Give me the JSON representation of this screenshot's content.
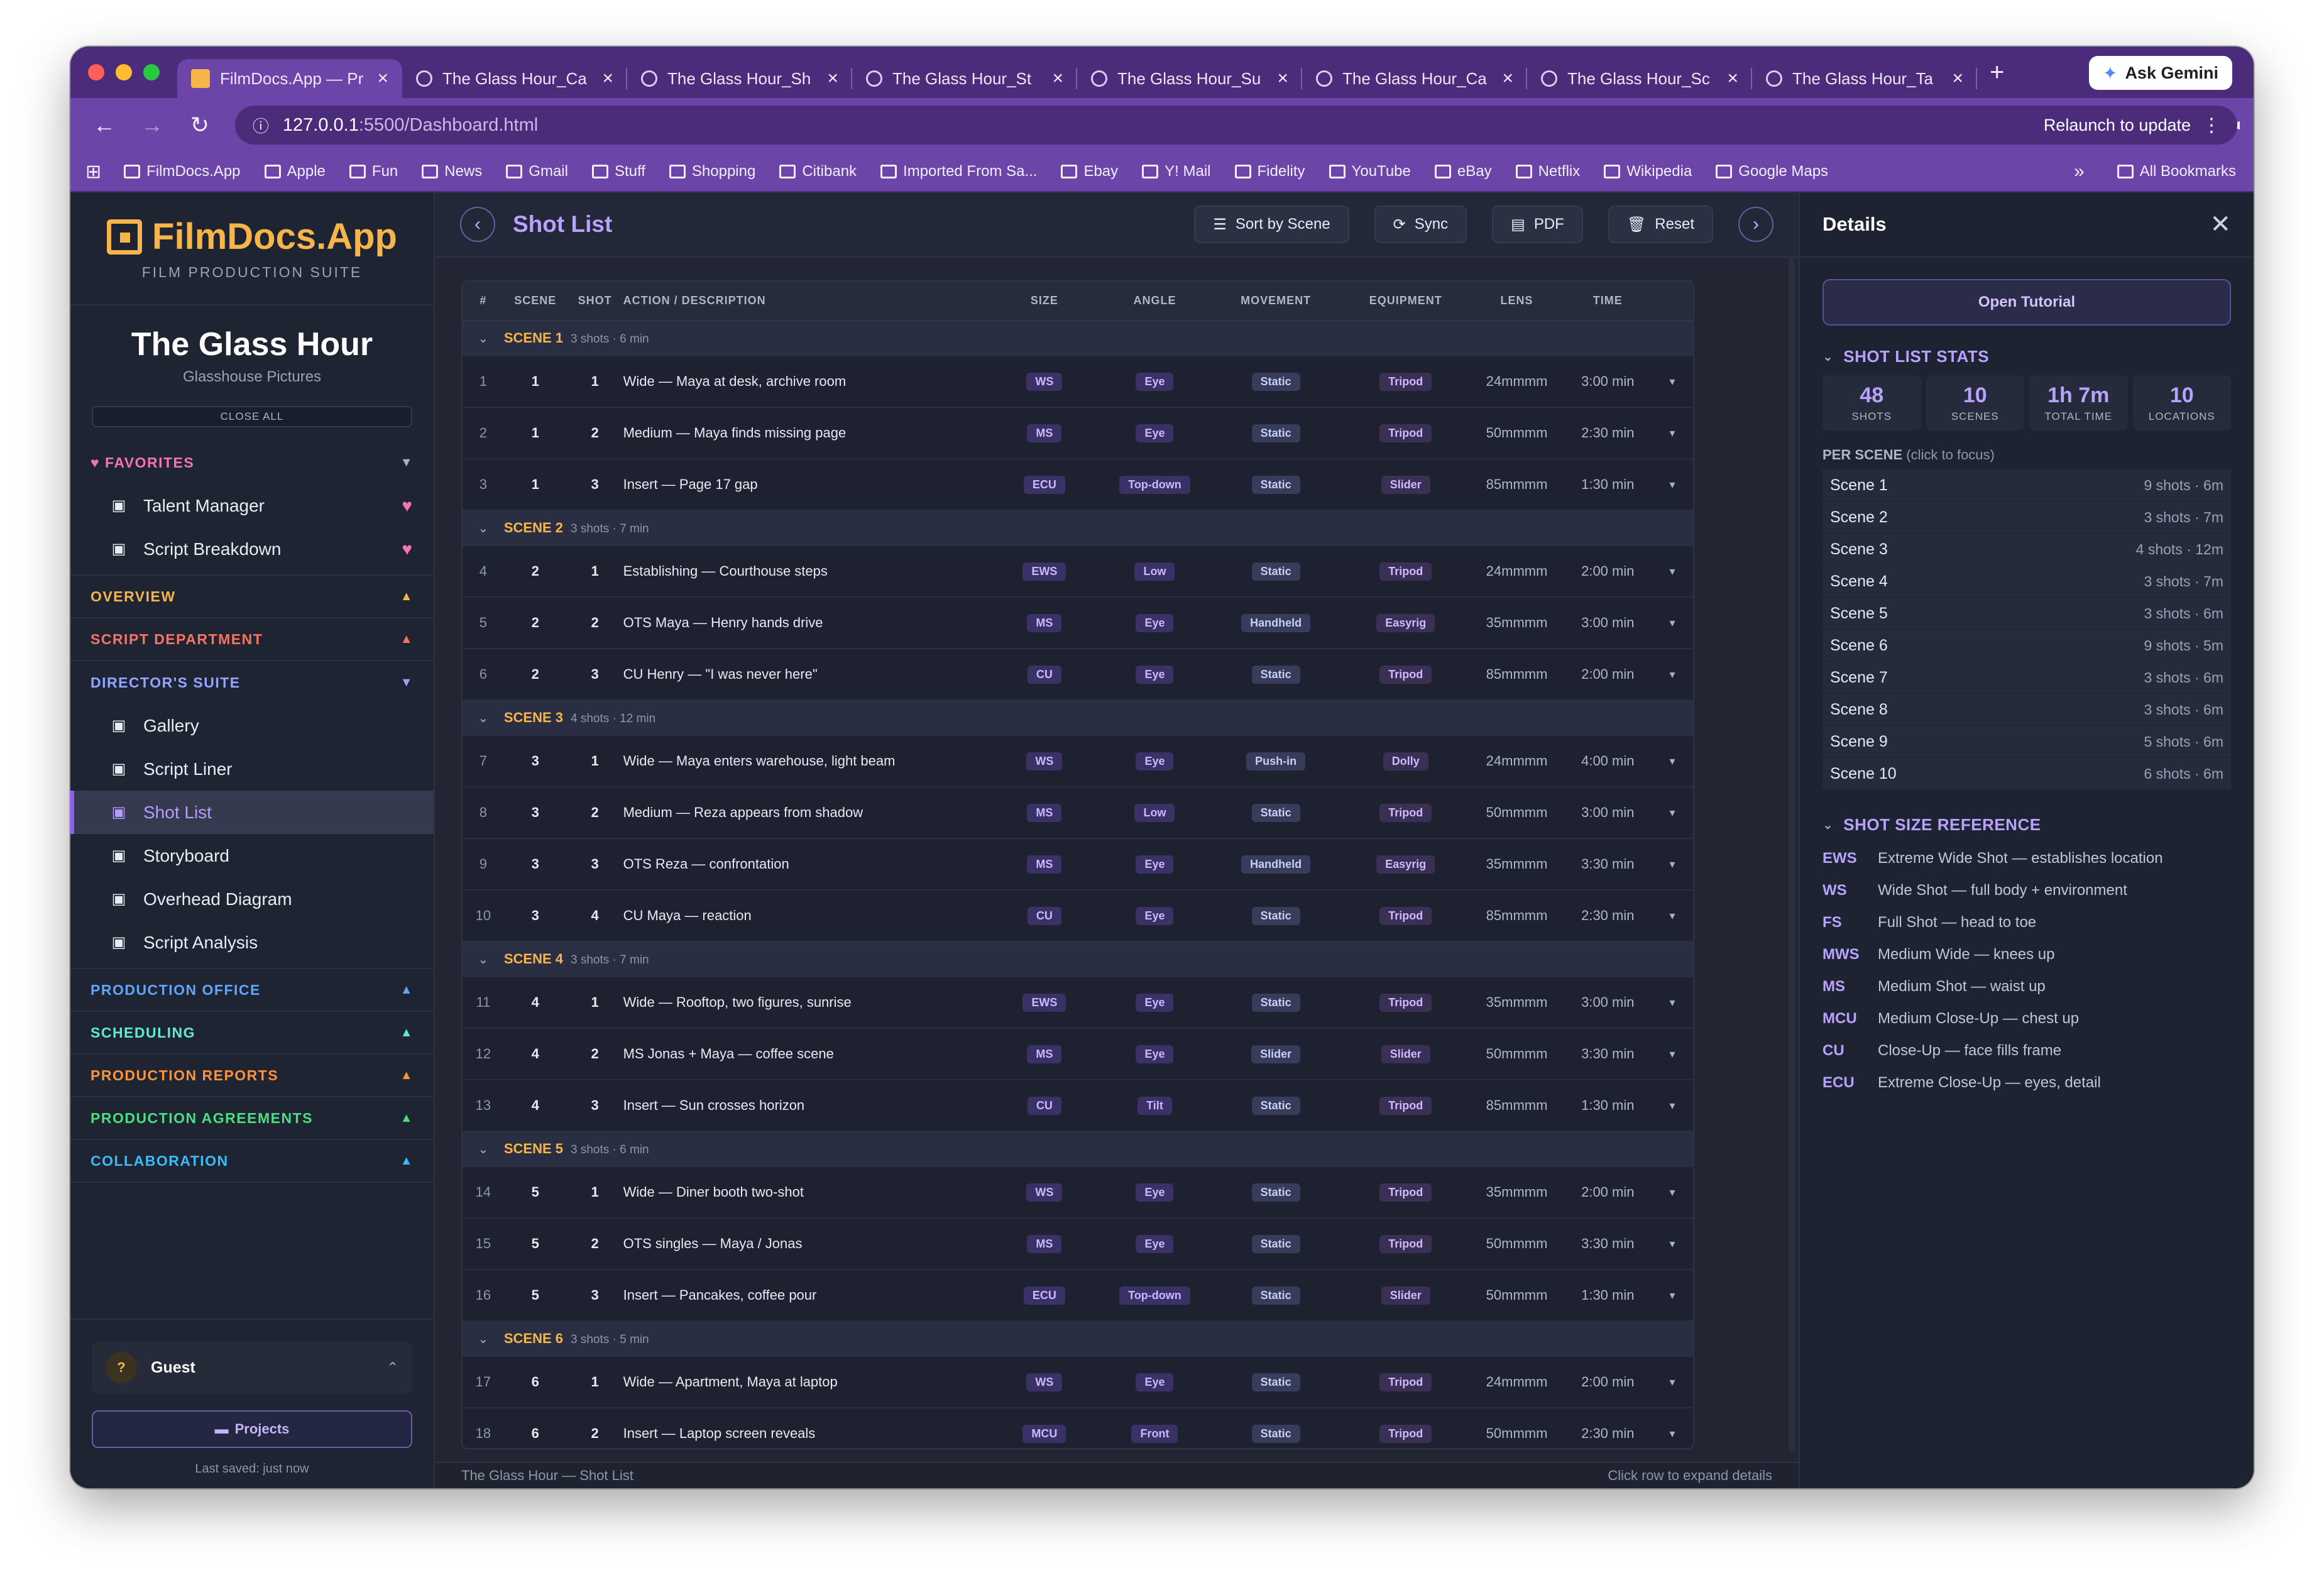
{
  "browser": {
    "tabs": [
      {
        "title": "FilmDocs.App — Pr",
        "active": true
      },
      {
        "title": "The Glass Hour_Ca",
        "active": false
      },
      {
        "title": "The Glass Hour_Sh",
        "active": false
      },
      {
        "title": "The Glass Hour_St",
        "active": false
      },
      {
        "title": "The Glass Hour_Su",
        "active": false
      },
      {
        "title": "The Glass Hour_Ca",
        "active": false
      },
      {
        "title": "The Glass Hour_Sc",
        "active": false
      },
      {
        "title": "The Glass Hour_Ta",
        "active": false
      }
    ],
    "gemini_label": "Ask Gemini",
    "url_host": "127.0.0.1",
    "url_path": ":5500/Dashboard.html",
    "relaunch_label": "Relaunch to update",
    "bookmarks": [
      "FilmDocs.App",
      "Apple",
      "Fun",
      "News",
      "Gmail",
      "Stuff",
      "Shopping",
      "Citibank",
      "Imported From Sa...",
      "Ebay",
      "Y! Mail",
      "Fidelity",
      "YouTube",
      "eBay",
      "Netflix",
      "Wikipedia",
      "Google Maps"
    ],
    "all_bookmarks": "All Bookmarks",
    "overflow": "»"
  },
  "sidebar": {
    "brand": "FilmDocs.App",
    "brand_sub": "FILM PRODUCTION SUITE",
    "project_name": "The Glass Hour",
    "studio": "Glasshouse Pictures",
    "close_all": "CLOSE ALL",
    "favorites_label": "FAVORITES",
    "favorites": [
      {
        "label": "Talent Manager",
        "icon": "clapper-icon"
      },
      {
        "label": "Script Breakdown",
        "icon": "notepad-icon"
      }
    ],
    "sections": {
      "overview": "OVERVIEW",
      "script_department": "SCRIPT DEPARTMENT",
      "directors_suite": "DIRECTOR'S SUITE",
      "production_office": "PRODUCTION OFFICE",
      "scheduling": "SCHEDULING",
      "production_reports": "PRODUCTION REPORTS",
      "production_agreements": "PRODUCTION AGREEMENTS",
      "collaboration": "COLLABORATION"
    },
    "directors_items": [
      {
        "label": "Gallery",
        "icon": "picture-icon"
      },
      {
        "label": "Script Liner",
        "icon": "pen-icon"
      },
      {
        "label": "Shot List",
        "icon": "clapper-icon",
        "active": true
      },
      {
        "label": "Storyboard",
        "icon": "picture-icon"
      },
      {
        "label": "Overhead Diagram",
        "icon": "ruler-triangle-icon"
      },
      {
        "label": "Script Analysis",
        "icon": "clapper-icon"
      }
    ],
    "guest": "Guest",
    "guest_avatar": "?",
    "projects": "Projects",
    "last_saved": "Last saved: just now"
  },
  "main": {
    "title": "Shot List",
    "buttons": {
      "sort": "Sort by Scene",
      "sync": "Sync",
      "pdf": "PDF",
      "reset": "Reset"
    },
    "columns": [
      "#",
      "SCENE",
      "SHOT",
      "ACTION / DESCRIPTION",
      "SIZE",
      "ANGLE",
      "MOVEMENT",
      "EQUIPMENT",
      "LENS",
      "TIME"
    ],
    "scenes": [
      {
        "label": "SCENE 1",
        "meta": "3 shots · 6 min",
        "rows": [
          [
            "1",
            "1",
            "1",
            "Wide — Maya at desk, archive room",
            "WS",
            "Eye",
            "Static",
            "Tripod",
            "24mmmm",
            "3:00 min"
          ],
          [
            "2",
            "1",
            "2",
            "Medium — Maya finds missing page",
            "MS",
            "Eye",
            "Static",
            "Tripod",
            "50mmmm",
            "2:30 min"
          ],
          [
            "3",
            "1",
            "3",
            "Insert — Page 17 gap",
            "ECU",
            "Top-down",
            "Static",
            "Slider",
            "85mmmm",
            "1:30 min"
          ]
        ]
      },
      {
        "label": "SCENE 2",
        "meta": "3 shots · 7 min",
        "rows": [
          [
            "4",
            "2",
            "1",
            "Establishing — Courthouse steps",
            "EWS",
            "Low",
            "Static",
            "Tripod",
            "24mmmm",
            "2:00 min"
          ],
          [
            "5",
            "2",
            "2",
            "OTS Maya — Henry hands drive",
            "MS",
            "Eye",
            "Handheld",
            "Easyrig",
            "35mmmm",
            "3:00 min"
          ],
          [
            "6",
            "2",
            "3",
            "CU Henry — \"I was never here\"",
            "CU",
            "Eye",
            "Static",
            "Tripod",
            "85mmmm",
            "2:00 min"
          ]
        ]
      },
      {
        "label": "SCENE 3",
        "meta": "4 shots · 12 min",
        "rows": [
          [
            "7",
            "3",
            "1",
            "Wide — Maya enters warehouse, light beam",
            "WS",
            "Eye",
            "Push-in",
            "Dolly",
            "24mmmm",
            "4:00 min"
          ],
          [
            "8",
            "3",
            "2",
            "Medium — Reza appears from shadow",
            "MS",
            "Low",
            "Static",
            "Tripod",
            "50mmmm",
            "3:00 min"
          ],
          [
            "9",
            "3",
            "3",
            "OTS Reza — confrontation",
            "MS",
            "Eye",
            "Handheld",
            "Easyrig",
            "35mmmm",
            "3:30 min"
          ],
          [
            "10",
            "3",
            "4",
            "CU Maya — reaction",
            "CU",
            "Eye",
            "Static",
            "Tripod",
            "85mmmm",
            "2:30 min"
          ]
        ]
      },
      {
        "label": "SCENE 4",
        "meta": "3 shots · 7 min",
        "rows": [
          [
            "11",
            "4",
            "1",
            "Wide — Rooftop, two figures, sunrise",
            "EWS",
            "Eye",
            "Static",
            "Tripod",
            "35mmmm",
            "3:00 min"
          ],
          [
            "12",
            "4",
            "2",
            "MS Jonas + Maya — coffee scene",
            "MS",
            "Eye",
            "Slider",
            "Slider",
            "50mmmm",
            "3:30 min"
          ],
          [
            "13",
            "4",
            "3",
            "Insert — Sun crosses horizon",
            "CU",
            "Tilt",
            "Static",
            "Tripod",
            "85mmmm",
            "1:30 min"
          ]
        ]
      },
      {
        "label": "SCENE 5",
        "meta": "3 shots · 6 min",
        "rows": [
          [
            "14",
            "5",
            "1",
            "Wide — Diner booth two-shot",
            "WS",
            "Eye",
            "Static",
            "Tripod",
            "35mmmm",
            "2:00 min"
          ],
          [
            "15",
            "5",
            "2",
            "OTS singles — Maya / Jonas",
            "MS",
            "Eye",
            "Static",
            "Tripod",
            "50mmmm",
            "3:30 min"
          ],
          [
            "16",
            "5",
            "3",
            "Insert — Pancakes, coffee pour",
            "ECU",
            "Top-down",
            "Static",
            "Slider",
            "50mmmm",
            "1:30 min"
          ]
        ]
      },
      {
        "label": "SCENE 6",
        "meta": "3 shots · 5 min",
        "rows": [
          [
            "17",
            "6",
            "1",
            "Wide — Apartment, Maya at laptop",
            "WS",
            "Eye",
            "Static",
            "Tripod",
            "24mmmm",
            "2:00 min"
          ],
          [
            "18",
            "6",
            "2",
            "Insert — Laptop screen reveals",
            "MCU",
            "Front",
            "Static",
            "Tripod",
            "50mmmm",
            "2:30 min"
          ]
        ]
      }
    ],
    "footer_left": "The Glass Hour — Shot List",
    "footer_right": "Click row to expand details"
  },
  "details": {
    "title": "Details",
    "tutorial": "Open Tutorial",
    "stats_title": "SHOT LIST STATS",
    "stats": [
      {
        "value": "48",
        "label": "SHOTS"
      },
      {
        "value": "10",
        "label": "SCENES"
      },
      {
        "value": "1h 7m",
        "label": "TOTAL TIME"
      },
      {
        "value": "10",
        "label": "LOCATIONS"
      }
    ],
    "per_scene_label": "PER SCENE",
    "per_scene_hint": "(click to focus)",
    "per_scene": [
      {
        "scene": "Scene 1",
        "info": "9 shots · 6m"
      },
      {
        "scene": "Scene 2",
        "info": "3 shots · 7m"
      },
      {
        "scene": "Scene 3",
        "info": "4 shots · 12m"
      },
      {
        "scene": "Scene 4",
        "info": "3 shots · 7m"
      },
      {
        "scene": "Scene 5",
        "info": "3 shots · 6m"
      },
      {
        "scene": "Scene 6",
        "info": "9 shots · 5m"
      },
      {
        "scene": "Scene 7",
        "info": "3 shots · 6m"
      },
      {
        "scene": "Scene 8",
        "info": "3 shots · 6m"
      },
      {
        "scene": "Scene 9",
        "info": "5 shots · 6m"
      },
      {
        "scene": "Scene 10",
        "info": "6 shots · 6m"
      }
    ],
    "ref_title": "SHOT SIZE REFERENCE",
    "reference": [
      {
        "code": "EWS",
        "desc": "Extreme Wide Shot — establishes location"
      },
      {
        "code": "WS",
        "desc": "Wide Shot — full body + environment"
      },
      {
        "code": "FS",
        "desc": "Full Shot — head to toe"
      },
      {
        "code": "MWS",
        "desc": "Medium Wide — knees up"
      },
      {
        "code": "MS",
        "desc": "Medium Shot — waist up"
      },
      {
        "code": "MCU",
        "desc": "Medium Close-Up — chest up"
      },
      {
        "code": "CU",
        "desc": "Close-Up — face fills frame"
      },
      {
        "code": "ECU",
        "desc": "Extreme Close-Up — eyes, detail"
      }
    ]
  },
  "colors": {
    "accent": "#b8a1ff",
    "scene_label": "#f6b54a",
    "favorites": "#f472b6",
    "overview": "#f6b54a",
    "script_department": "#f97360",
    "directors_suite": "#93a5ff",
    "production_office": "#60a5fa",
    "scheduling": "#5eead4",
    "production_reports": "#fb923c",
    "production_agreements": "#4ade80",
    "collaboration": "#38bdf8"
  }
}
